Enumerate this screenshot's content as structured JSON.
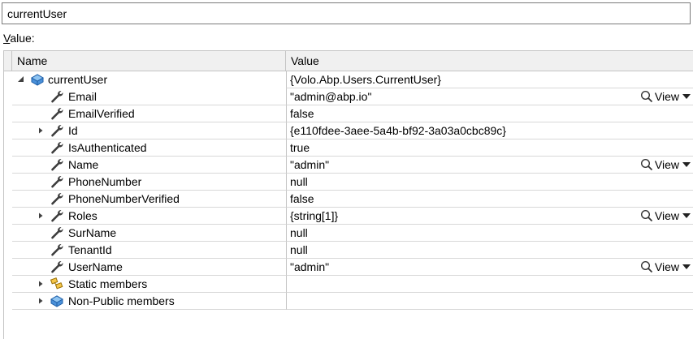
{
  "expression": {
    "value": "currentUser"
  },
  "value_label": {
    "underlined": "V",
    "rest": "alue:"
  },
  "grid": {
    "headers": {
      "name": "Name",
      "value": "Value"
    },
    "root": {
      "name": "currentUser",
      "value": "{Volo.Abp.Users.CurrentUser}",
      "expanded": true,
      "icon": "class-object-icon"
    },
    "rows": [
      {
        "name": "Email",
        "value": "\"admin@abp.io\"",
        "has_view": true,
        "expandable": false
      },
      {
        "name": "EmailVerified",
        "value": "false",
        "has_view": false,
        "expandable": false
      },
      {
        "name": "Id",
        "value": "{e110fdee-3aee-5a4b-bf92-3a03a0cbc89c}",
        "has_view": false,
        "expandable": true
      },
      {
        "name": "IsAuthenticated",
        "value": "true",
        "has_view": false,
        "expandable": false
      },
      {
        "name": "Name",
        "value": "\"admin\"",
        "has_view": true,
        "expandable": false
      },
      {
        "name": "PhoneNumber",
        "value": "null",
        "has_view": false,
        "expandable": false
      },
      {
        "name": "PhoneNumberVerified",
        "value": "false",
        "has_view": false,
        "expandable": false
      },
      {
        "name": "Roles",
        "value": "{string[1]}",
        "has_view": true,
        "expandable": true
      },
      {
        "name": "SurName",
        "value": "null",
        "has_view": false,
        "expandable": false
      },
      {
        "name": "TenantId",
        "value": "null",
        "has_view": false,
        "expandable": false
      },
      {
        "name": "UserName",
        "value": "\"admin\"",
        "has_view": true,
        "expandable": false
      }
    ],
    "groups": [
      {
        "name": "Static members",
        "value": "",
        "icon": "static-members-icon"
      },
      {
        "name": "Non-Public members",
        "value": "",
        "icon": "non-public-members-icon"
      }
    ],
    "view_label": "View"
  },
  "colors": {
    "border": "#c4c4c4",
    "header_bg": "#f0f0f0",
    "wrench": "#3c3c3c",
    "class_icon": "#1e73be"
  }
}
